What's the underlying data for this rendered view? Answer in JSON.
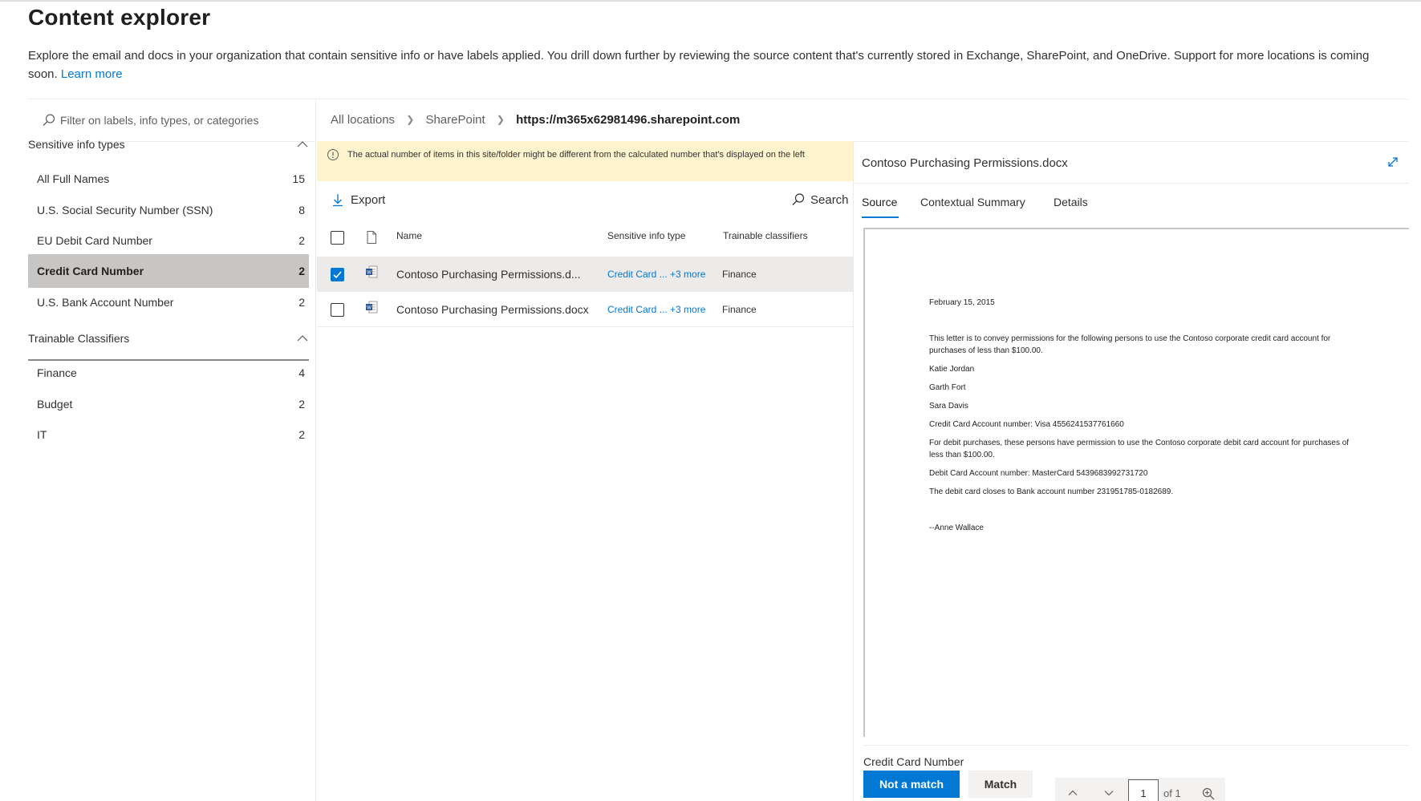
{
  "header": {
    "title": "Content explorer",
    "description": "Explore the email and docs in your organization that contain sensitive info or have labels applied. You drill down further by reviewing the source content that's currently stored in Exchange, SharePoint, and OneDrive. Support for more locations is coming soon.",
    "learn_more": "Learn more"
  },
  "filter": {
    "placeholder": "Filter on labels, info types, or categories"
  },
  "sensitive_info_types": {
    "title": "Sensitive info types",
    "items": [
      {
        "label": "All Full Names",
        "count": "15"
      },
      {
        "label": "U.S. Social Security Number (SSN)",
        "count": "8"
      },
      {
        "label": "EU Debit Card Number",
        "count": "2"
      },
      {
        "label": "Credit Card Number",
        "count": "2"
      },
      {
        "label": "U.S. Bank Account Number",
        "count": "2"
      }
    ]
  },
  "trainable_classifiers": {
    "title": "Trainable Classifiers",
    "items": [
      {
        "label": "Finance",
        "count": "4"
      },
      {
        "label": "Budget",
        "count": "2"
      },
      {
        "label": "IT",
        "count": "2"
      }
    ]
  },
  "breadcrumb": [
    "All locations",
    "SharePoint",
    "https://m365x62981496.sharepoint.com"
  ],
  "warning": "The actual number of items in this site/folder might be different from the calculated number that's displayed on the left",
  "toolbar": {
    "export": "Export",
    "search": "Search"
  },
  "table": {
    "headers": {
      "name": "Name",
      "sensitive_info_type": "Sensitive info type",
      "trainable_classifiers": "Trainable classifiers"
    },
    "rows": [
      {
        "name": "Contoso Purchasing Permissions.d...",
        "sit": "Credit Card ... +3 more",
        "tc": "Finance",
        "checked": true
      },
      {
        "name": "Contoso Purchasing Permissions.docx",
        "sit": "Credit Card ... +3 more",
        "tc": "Finance",
        "checked": false
      }
    ]
  },
  "detail": {
    "title": "Contoso Purchasing Permissions.docx",
    "tabs": [
      "Source",
      "Contextual Summary",
      "Details"
    ],
    "document": {
      "date": "February 15, 2015",
      "p1": "This letter is to convey permissions for the following persons to use the Contoso corporate credit card account for purchases of less than $100.00.",
      "name1": "Katie Jordan",
      "name2": "Garth Fort",
      "name3": "Sara Davis",
      "credit": "Credit Card Account number: Visa 4556241537761660",
      "p2": "For debit purchases, these persons have permission to use the Contoso corporate debit card account for purchases of less than $100.00.",
      "debit": "Debit Card Account number: MasterCard 5439683992731720",
      "bank": "The debit card closes to Bank account number 231951785-0182689.",
      "sign": "--Anne Wallace"
    },
    "pager": {
      "page": "1",
      "of": "of 1"
    },
    "match_label": "Credit Card Number",
    "not_match": "Not a match",
    "match": "Match"
  }
}
